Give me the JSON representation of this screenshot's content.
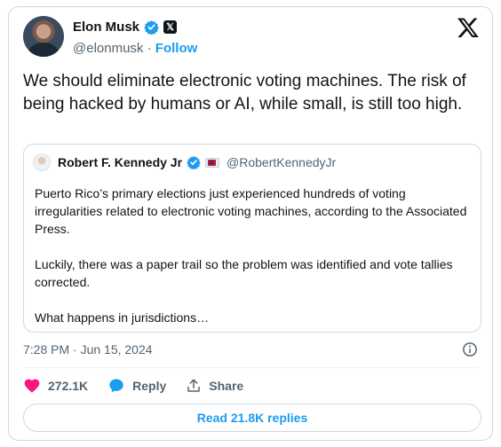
{
  "author": {
    "name": "Elon Musk",
    "handle": "@elonmusk",
    "separator": "·",
    "follow_label": "Follow"
  },
  "tweet": {
    "text": "We should eliminate electronic voting machines. The risk of being hacked by humans or AI, while small, is still too high."
  },
  "quote": {
    "name": "Robert F. Kennedy Jr",
    "handle": "@RobertKennedyJr",
    "text": "Puerto Rico’s primary elections just experienced hundreds of voting irregularities related to electronic voting machines, according to the Associated Press.\n\nLuckily, there was a paper trail so the problem was identified and vote tallies corrected.\n\nWhat happens in jurisdictions…"
  },
  "meta": {
    "timestamp": "7:28 PM · Jun 15, 2024"
  },
  "actions": {
    "likes": "272.1K",
    "reply_label": "Reply",
    "share_label": "Share"
  },
  "replies_button": "Read 21.8K replies",
  "colors": {
    "accent": "#1d9bf0",
    "like": "#f91880",
    "text": "#0f1419",
    "secondary": "#536471",
    "border": "#cfd9de"
  },
  "icons": [
    "verified-badge-icon",
    "x-logo-icon",
    "info-icon",
    "heart-icon",
    "reply-bubble-icon",
    "share-icon"
  ]
}
